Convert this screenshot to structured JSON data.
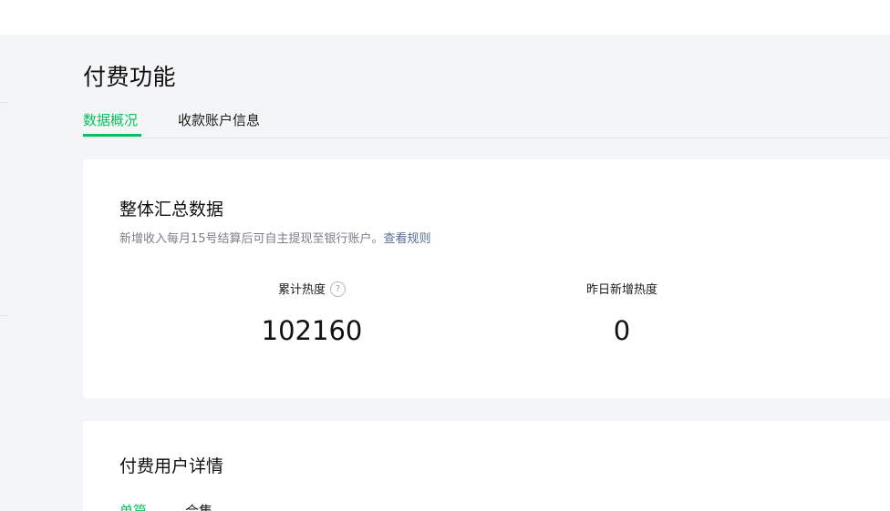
{
  "page": {
    "title": "付费功能"
  },
  "tabs": [
    {
      "label": "数据概况",
      "active": true
    },
    {
      "label": "收款账户信息",
      "active": false
    }
  ],
  "summary": {
    "title": "整体汇总数据",
    "description": "新增收入每月15号结算后可自主提现至银行账户。",
    "rule_link": "查看规则",
    "stats": [
      {
        "label": "累计热度",
        "value": "102160",
        "help_icon": "question-circle-icon"
      },
      {
        "label": "昨日新增热度",
        "value": "0"
      }
    ]
  },
  "paid_users": {
    "title": "付费用户详情",
    "tabs": [
      {
        "label": "单篇",
        "active": true
      },
      {
        "label": "合集",
        "active": false
      }
    ]
  },
  "colors": {
    "accent": "#07c160",
    "link": "#576b95",
    "background": "#f4f5f7",
    "card": "#ffffff"
  }
}
